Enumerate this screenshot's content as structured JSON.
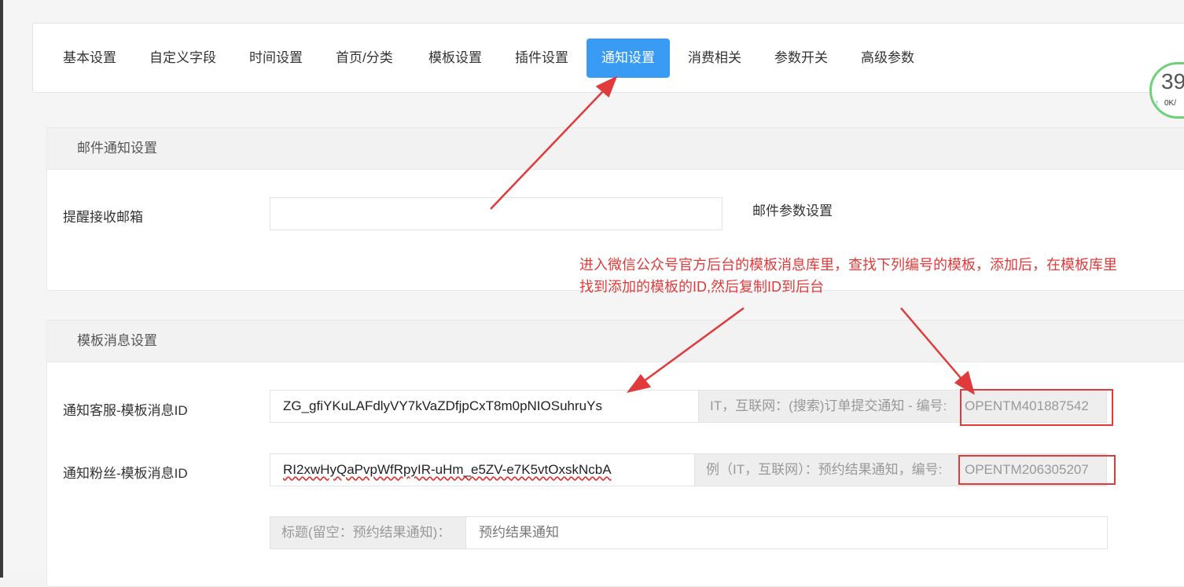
{
  "tabs": [
    {
      "label": "基本设置",
      "active": false
    },
    {
      "label": "自定义字段",
      "active": false
    },
    {
      "label": "时间设置",
      "active": false
    },
    {
      "label": "首页/分类",
      "active": false
    },
    {
      "label": "模板设置",
      "active": false
    },
    {
      "label": "插件设置",
      "active": false
    },
    {
      "label": "通知设置",
      "active": true
    },
    {
      "label": "消费相关",
      "active": false
    },
    {
      "label": "参数开关",
      "active": false
    },
    {
      "label": "高级参数",
      "active": false
    }
  ],
  "speed_widget": {
    "value": "39",
    "sub": "0K/"
  },
  "email_section": {
    "title": "邮件通知设置",
    "remind_email_label": "提醒接收邮箱",
    "remind_email_value": "",
    "params_link": "邮件参数设置"
  },
  "template_section": {
    "title": "模板消息设置",
    "service": {
      "label": "通知客服-模板消息ID",
      "value": "ZG_gfiYKuLAFdlyVY7kVaZDfjpCxT8m0pNIOSuhruYs",
      "hint": "IT，互联网：(搜索)订单提交通知 - 编号:",
      "code": "OPENTM401887542"
    },
    "fans": {
      "label": "通知粉丝-模板消息ID",
      "value": "RI2xwHyQaPvpWfRpyIR-uHm_e5ZV-e7K5vtOxskNcbA",
      "hint": "例（IT，互联网）：预约结果通知，编号:",
      "code": "OPENTM206305207"
    },
    "title_row": {
      "addon": "标题(留空：预约结果通知)：",
      "value": "预约结果通知"
    }
  },
  "annotation": {
    "line1": "进入微信公众号官方后台的模板消息库里，查找下列编号的模板，添加后，在模板库里",
    "line2": "找到添加的模板的ID,然后复制ID到后台",
    "color": "#e03a3a"
  },
  "colors": {
    "accent": "#3a9bf4",
    "annotation": "#e03a3a"
  }
}
